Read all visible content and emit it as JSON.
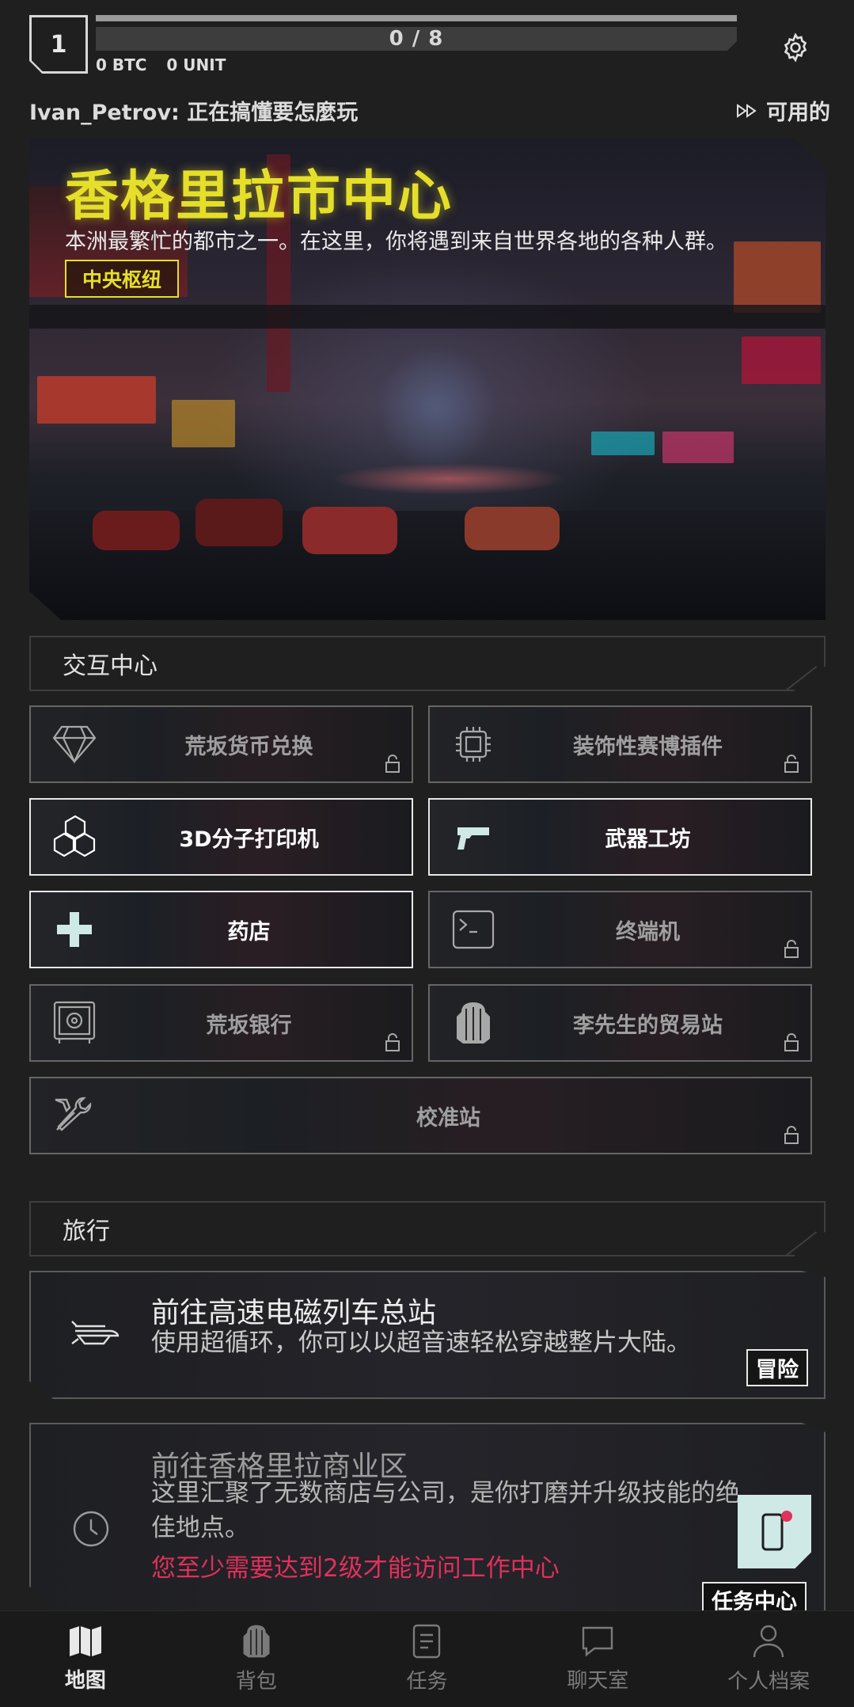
{
  "header": {
    "level": "1",
    "xp_text": "0 / 8",
    "xp_progress": 0,
    "btc": "0 BTC",
    "unit": "0 UNIT",
    "player_status": "Ivan_Petrov: 正在搞懂要怎麼玩",
    "available_label": "可用的"
  },
  "hero": {
    "title": "香格里拉市中心",
    "description": "本洲最繁忙的都市之一。在这里，你将遇到来自世界各地的各种人群。",
    "tag": "中央枢纽"
  },
  "interaction": {
    "section_title": "交互中心",
    "tiles": [
      {
        "label": "荒坂货币兑换",
        "icon": "diamond-icon",
        "locked": true
      },
      {
        "label": "装饰性赛博插件",
        "icon": "chip-icon",
        "locked": true
      },
      {
        "label": "3D分子打印机",
        "icon": "molecule-icon",
        "locked": false
      },
      {
        "label": "武器工坊",
        "icon": "gun-icon",
        "locked": false
      },
      {
        "label": "药店",
        "icon": "plus-icon",
        "locked": false
      },
      {
        "label": "终端机",
        "icon": "terminal-icon",
        "locked": true
      },
      {
        "label": "荒坂银行",
        "icon": "safe-icon",
        "locked": true
      },
      {
        "label": "李先生的贸易站",
        "icon": "backpack-icon",
        "locked": true
      },
      {
        "label": "校准站",
        "icon": "tools-icon",
        "locked": true
      }
    ]
  },
  "travel": {
    "section_title": "旅行",
    "cards": [
      {
        "title": "前往高速电磁列车总站",
        "description": "使用超循环，你可以以超音速轻松穿越整片大陆。",
        "button": "冒险",
        "icon": "train-icon"
      },
      {
        "title": "前往香格里拉商业区",
        "description_line1": "这里汇聚了无数商店与公司，是你打磨并升级技能的绝",
        "description_line2": "佳地点。",
        "warning": "您至少需要达到2级才能访问工作中心",
        "icon": "clock-icon"
      }
    ],
    "mission_center": "任务中心"
  },
  "nav": [
    {
      "label": "地图",
      "icon": "map-icon",
      "active": true
    },
    {
      "label": "背包",
      "icon": "backpack-icon",
      "active": false
    },
    {
      "label": "任务",
      "icon": "document-icon",
      "active": false
    },
    {
      "label": "聊天室",
      "icon": "chat-icon",
      "active": false
    },
    {
      "label": "个人档案",
      "icon": "user-icon",
      "active": false
    }
  ],
  "colors": {
    "accent_yellow": "#e5df2a",
    "warning_red": "#e0305c",
    "mint": "#cfe9e6",
    "background": "#1f1f1f"
  }
}
